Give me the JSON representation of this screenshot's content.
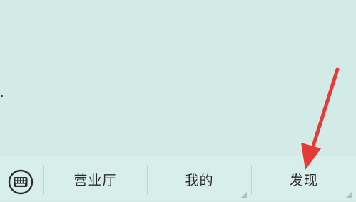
{
  "bottom_menu": {
    "keyboard_icon": "keyboard-icon",
    "items": [
      {
        "label": "营业厅"
      },
      {
        "label": "我的"
      },
      {
        "label": "发现"
      }
    ]
  },
  "annotation": {
    "arrow_color": "#e53a35"
  },
  "colors": {
    "background": "#d3ebe6",
    "menu_background": "#d8eeea",
    "text": "#2b2b2b"
  }
}
